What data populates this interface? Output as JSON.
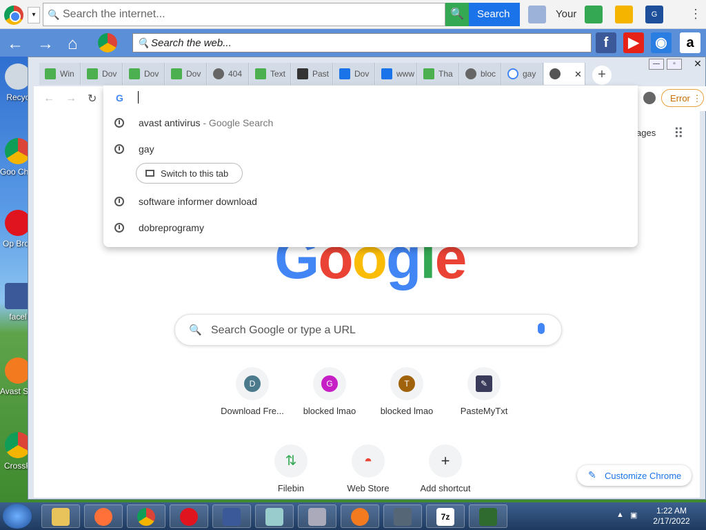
{
  "toolbar1": {
    "search_placeholder": "Search the internet...",
    "search_button": "Search",
    "your_label": "Your"
  },
  "toolbar2": {
    "search_placeholder": "Search the web..."
  },
  "tabs": [
    {
      "label": "Win"
    },
    {
      "label": "Dov"
    },
    {
      "label": "Dov"
    },
    {
      "label": "Dov"
    },
    {
      "label": "404"
    },
    {
      "label": "Text"
    },
    {
      "label": "Past"
    },
    {
      "label": "Dov"
    },
    {
      "label": "www"
    },
    {
      "label": "Tha"
    },
    {
      "label": "bloc"
    },
    {
      "label": "gay"
    },
    {
      "label": ""
    }
  ],
  "omnibox": {
    "suggestions": [
      {
        "text": "avast antivirus",
        "suffix": " - Google Search"
      },
      {
        "text": "gay",
        "suffix": ""
      },
      {
        "text": "software informer download",
        "suffix": ""
      },
      {
        "text": "dobreprogramy",
        "suffix": ""
      }
    ],
    "switch_tab": "Switch to this tab"
  },
  "status": {
    "error": "Error"
  },
  "google": {
    "images_partial": "ages",
    "search_placeholder": "Search Google or type a URL",
    "shortcuts": [
      {
        "initial": "D",
        "label": "Download Fre...",
        "color": "#4a7a8c"
      },
      {
        "initial": "G",
        "label": "blocked lmao",
        "color": "#c51fc5"
      },
      {
        "initial": "T",
        "label": "blocked lmao",
        "color": "#a0620b"
      },
      {
        "initial": "✎",
        "label": "PasteMyTxt",
        "color": "#3a3a5a"
      },
      {
        "initial": "⇅",
        "label": "Filebin",
        "color": "#34a853"
      },
      {
        "initial": "◓",
        "label": "Web Store",
        "color": "#ea4335"
      },
      {
        "initial": "+",
        "label": "Add shortcut",
        "color": "#5f6368"
      }
    ],
    "customize": "Customize Chrome"
  },
  "desktop_icons": [
    {
      "label": "Recyc"
    },
    {
      "label": "Goo Chro"
    },
    {
      "label": "Op Brov"
    },
    {
      "label": "facel"
    },
    {
      "label": "Avast S Brov"
    },
    {
      "label": "CrossR"
    }
  ],
  "taskbar": {
    "time": "1:22 AM",
    "date": "2/17/2022",
    "apps": [
      "explorer",
      "firefox",
      "chrome",
      "opera",
      "facebook",
      "notes",
      "control-panel",
      "avast",
      "chess",
      "7zip",
      "cannabis"
    ]
  }
}
